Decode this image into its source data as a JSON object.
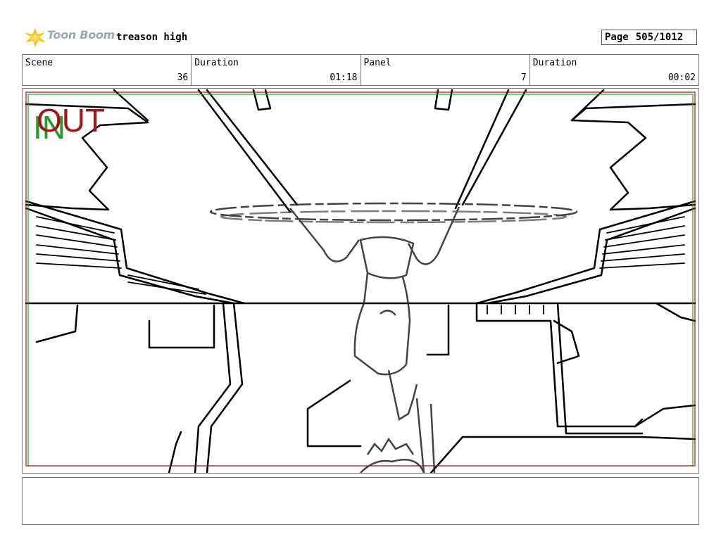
{
  "header": {
    "logo_text": "Toon Boom",
    "project_title": "treason high",
    "page_label": "Page",
    "page_value": "505/1012"
  },
  "info": {
    "scene_label": "Scene",
    "scene_value": "36",
    "duration1_label": "Duration",
    "duration1_value": "01:18",
    "panel_label": "Panel",
    "panel_value": "7",
    "duration2_label": "Duration",
    "duration2_value": "00:02"
  },
  "panel": {
    "in_marker": "IN",
    "out_marker": "OUT"
  },
  "notes": {
    "text": ""
  },
  "colors": {
    "in_marker": "#2a9a2a",
    "out_marker": "#a01818",
    "logo_star": "#f5c400",
    "logo_text": "#9aa7b8"
  }
}
